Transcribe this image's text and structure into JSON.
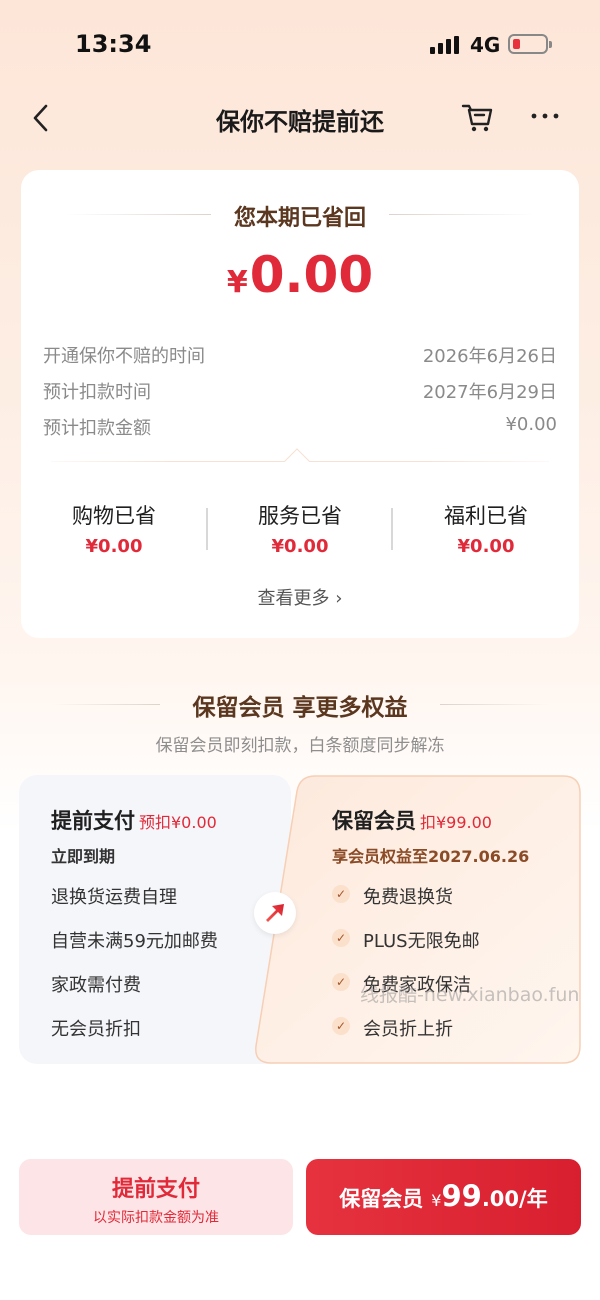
{
  "status": {
    "time": "13:34",
    "network": "4G"
  },
  "nav": {
    "title": "保你不赔提前还",
    "back_icon": "chevron-left-icon",
    "cart_icon": "cart-icon",
    "more_icon": "more-icon"
  },
  "savings": {
    "heading": "您本期已省回",
    "currency": "¥",
    "amount": "0.00",
    "info": [
      {
        "label": "开通保你不赔的时间",
        "value": "2026年6月26日"
      },
      {
        "label": "预计扣款时间",
        "value": "2027年6月29日"
      },
      {
        "label": "预计扣款金额",
        "value": "¥0.00"
      }
    ],
    "stats": [
      {
        "label": "购物已省",
        "value": "¥0.00"
      },
      {
        "label": "服务已省",
        "value": "¥0.00"
      },
      {
        "label": "福利已省",
        "value": "¥0.00"
      }
    ],
    "see_more": "查看更多 ›"
  },
  "membership": {
    "title": "保留会员 享更多权益",
    "subtitle": "保留会员即刻扣款，白条额度同步解冻"
  },
  "prepay_option": {
    "title": "提前支付",
    "tag": "预扣¥0.00",
    "subtitle": "立即到期",
    "items": [
      "退换货运费自理",
      "自营未满59元加邮费",
      "家政需付费",
      "无会员折扣"
    ]
  },
  "keep_option": {
    "title": "保留会员",
    "tag": "扣¥99.00",
    "subtitle": "享会员权益至2027.06.26",
    "items": [
      "免费退换货",
      "PLUS无限免邮",
      "免费家政保洁",
      "会员折上折"
    ]
  },
  "watermark": "线报酷-new.xianbao.fun",
  "buttons": {
    "prepay": {
      "label": "提前支付",
      "sub": "以实际扣款金额为准"
    },
    "keep": {
      "label": "保留会员",
      "currency": "¥",
      "price": "99",
      "decimal": ".00",
      "unit": "/年"
    }
  },
  "colors": {
    "accent_red": "#e12a39",
    "brown_text": "#5b3720",
    "keep_card_bg": "#fdf0e6"
  }
}
